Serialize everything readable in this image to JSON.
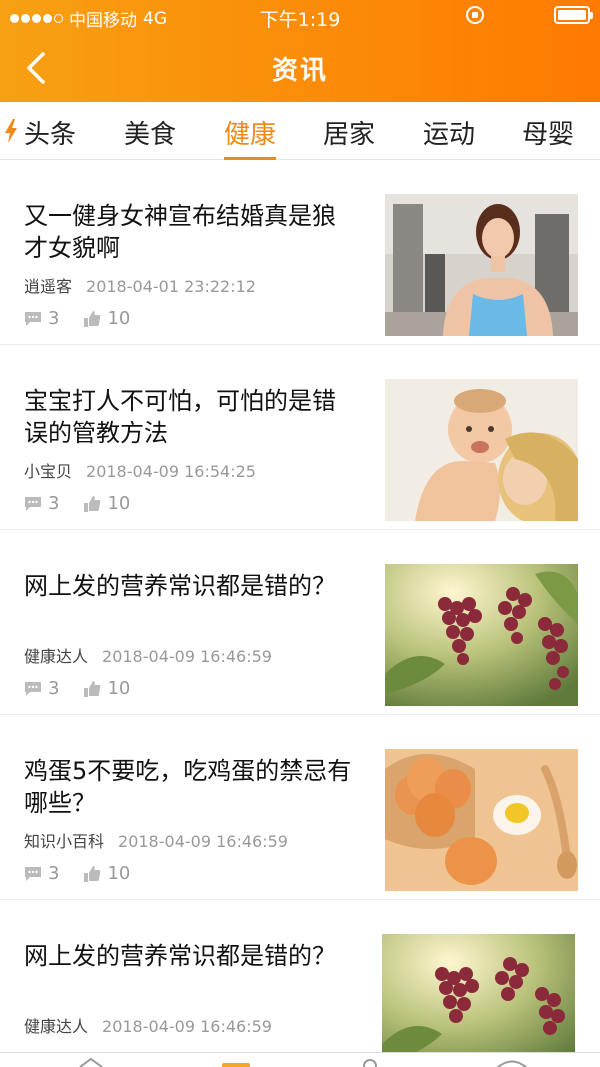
{
  "status_bar": {
    "carrier": "中国移动",
    "network": "4G",
    "time": "下午1:19"
  },
  "nav": {
    "title": "资讯"
  },
  "tabs": [
    {
      "label": "头条"
    },
    {
      "label": "美食"
    },
    {
      "label": "健康",
      "active": true
    },
    {
      "label": "居家"
    },
    {
      "label": "运动"
    },
    {
      "label": "母婴"
    }
  ],
  "colors": {
    "header_start": "#f7a012",
    "header_end": "#ff7a00",
    "accent": "#f08a17"
  },
  "articles": [
    {
      "title": "又一健身女神宣布结婚真是狼才女貌啊",
      "author": "逍遥客",
      "date": "2018-04-01  23:22:12",
      "comments": "3",
      "likes": "10",
      "image": "woman-gym-photo"
    },
    {
      "title": "宝宝打人不可怕，可怕的是错误的管教方法",
      "author": "小宝贝",
      "date": "2018-04-09  16:54:25",
      "comments": "3",
      "likes": "10",
      "image": "mother-baby-photo"
    },
    {
      "title": "网上发的营养常识都是错的？",
      "author": "健康达人",
      "date": "2018-04-09  16:46:59",
      "comments": "3",
      "likes": "10",
      "image": "grapes-photo"
    },
    {
      "title": "鸡蛋5不要吃，吃鸡蛋的禁忌有哪些？",
      "author": "知识小百科",
      "date": "2018-04-09  16:46:59",
      "comments": "3",
      "likes": "10",
      "image": "eggs-photo"
    },
    {
      "title": "网上发的营养常识都是错的？",
      "author": "健康达人",
      "date": "2018-04-09  16:46:59",
      "comments": "",
      "likes": "",
      "image": "grapes-photo"
    }
  ]
}
